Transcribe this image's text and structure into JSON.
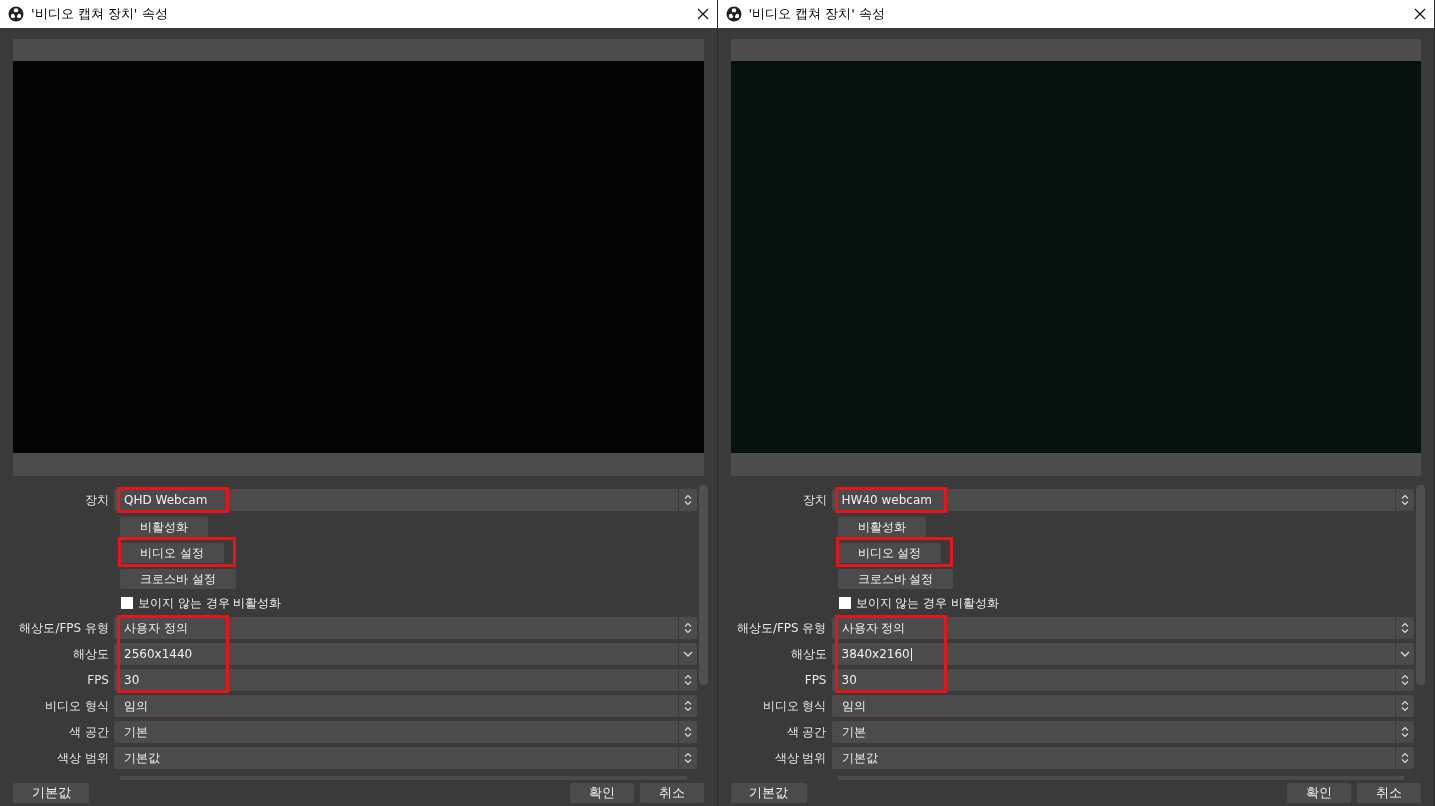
{
  "windows": [
    {
      "title": "'비디오 캡쳐 장치' 속성",
      "rows": [
        {
          "kind": "select",
          "label": "장치",
          "value": "QHD Webcam",
          "editable": false,
          "highlighted": true,
          "focused": false
        },
        {
          "kind": "button",
          "text": "비활성화",
          "highlighted": false
        },
        {
          "kind": "button",
          "text": "비디오 설정",
          "highlighted": true
        },
        {
          "kind": "button",
          "text": "크로스바 설정",
          "highlighted": false
        },
        {
          "kind": "checkbox",
          "text": "보이지 않는 경우 비활성화",
          "checked": false
        },
        {
          "kind": "select",
          "label": "해상도/FPS 유형",
          "value": "사용자 정의",
          "editable": false,
          "highlighted": true,
          "focused": false
        },
        {
          "kind": "select",
          "label": "해상도",
          "value": "2560x1440",
          "editable": true,
          "highlighted": true,
          "focused": false
        },
        {
          "kind": "select",
          "label": "FPS",
          "value": "30",
          "editable": false,
          "highlighted": true,
          "focused": false
        },
        {
          "kind": "select",
          "label": "비디오 형식",
          "value": "임의",
          "editable": false,
          "highlighted": false,
          "focused": false
        },
        {
          "kind": "select",
          "label": "색 공간",
          "value": "기본",
          "editable": false,
          "highlighted": false,
          "focused": false
        },
        {
          "kind": "select",
          "label": "색상 범위",
          "value": "기본값",
          "editable": false,
          "highlighted": false,
          "focused": false
        }
      ],
      "footer": {
        "defaults": "기본값",
        "ok": "확인",
        "cancel": "취소"
      }
    },
    {
      "title": "'비디오 캡쳐 장치' 속성",
      "rows": [
        {
          "kind": "select",
          "label": "장치",
          "value": "HW40 webcam",
          "editable": false,
          "highlighted": true,
          "focused": false
        },
        {
          "kind": "button",
          "text": "비활성화",
          "highlighted": false
        },
        {
          "kind": "button",
          "text": "비디오 설정",
          "highlighted": true
        },
        {
          "kind": "button",
          "text": "크로스바 설정",
          "highlighted": false
        },
        {
          "kind": "checkbox",
          "text": "보이지 않는 경우 비활성화",
          "checked": false
        },
        {
          "kind": "select",
          "label": "해상도/FPS 유형",
          "value": "사용자 정의",
          "editable": false,
          "highlighted": true,
          "focused": false
        },
        {
          "kind": "select",
          "label": "해상도",
          "value": "3840x2160",
          "editable": true,
          "highlighted": true,
          "focused": true
        },
        {
          "kind": "select",
          "label": "FPS",
          "value": "30",
          "editable": false,
          "highlighted": true,
          "focused": false
        },
        {
          "kind": "select",
          "label": "비디오 형식",
          "value": "임의",
          "editable": false,
          "highlighted": false,
          "focused": false
        },
        {
          "kind": "select",
          "label": "색 공간",
          "value": "기본",
          "editable": false,
          "highlighted": false,
          "focused": false
        },
        {
          "kind": "select",
          "label": "색상 범위",
          "value": "기본값",
          "editable": false,
          "highlighted": false,
          "focused": false
        }
      ],
      "footer": {
        "defaults": "기본값",
        "ok": "확인",
        "cancel": "취소"
      }
    }
  ]
}
